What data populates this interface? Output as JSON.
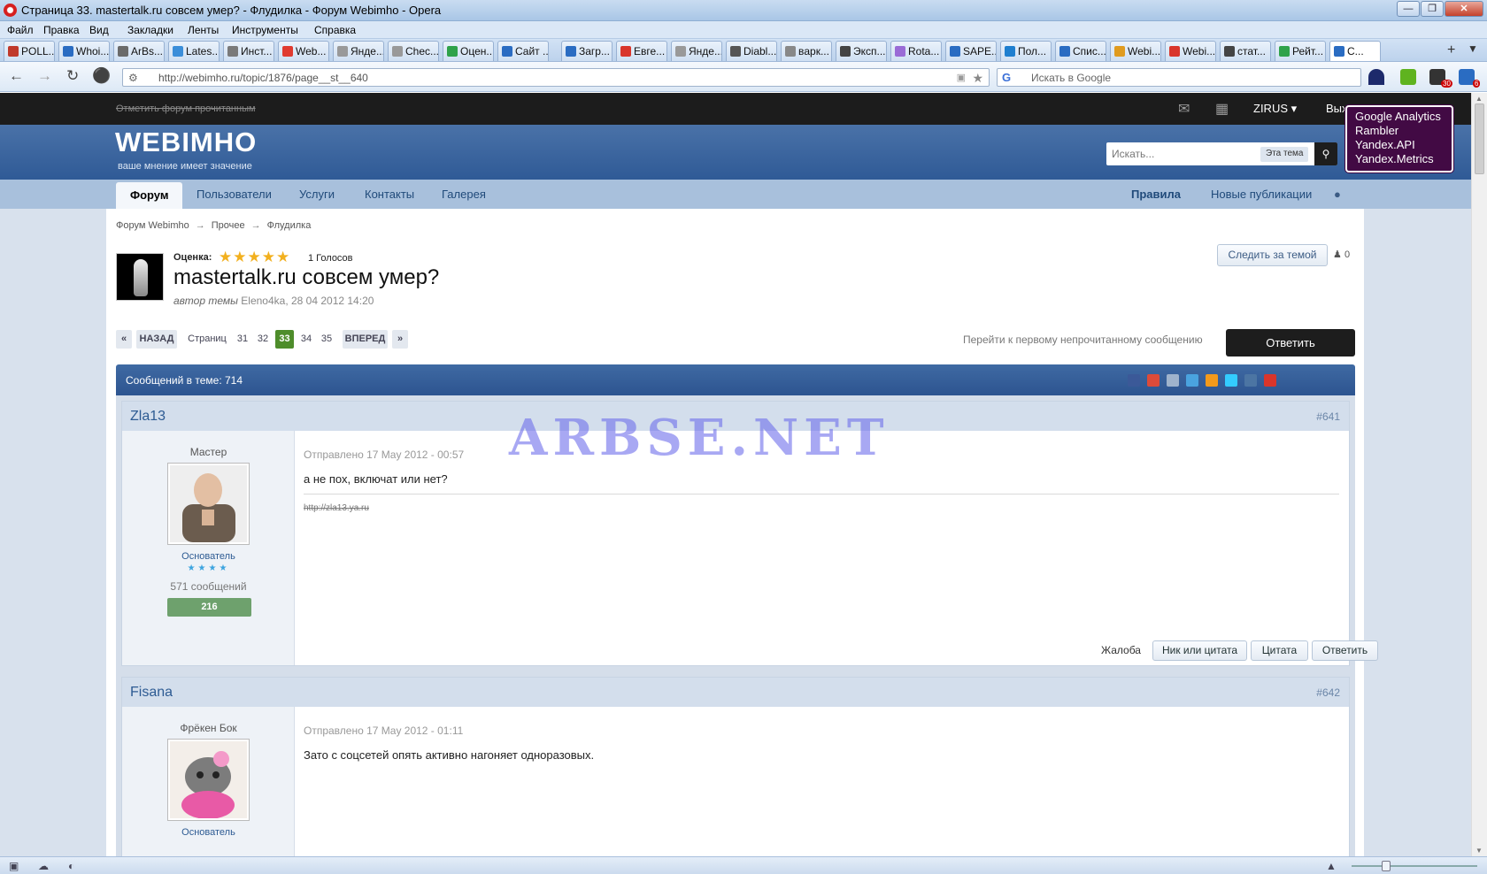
{
  "window": {
    "title": "Страница 33. mastertalk.ru совсем умер? - Флудилка - Форум Webimho - Opera",
    "controls": [
      "minimize",
      "maximize",
      "close"
    ]
  },
  "menu": [
    "Файл",
    "Правка",
    "Вид",
    "Закладки",
    "Ленты",
    "Инструменты",
    "Справка"
  ],
  "tabs": [
    {
      "label": "POLL...",
      "color": "#c0392b"
    },
    {
      "label": "Whoi...",
      "color": "#2a6cc2"
    },
    {
      "label": "ArBs...",
      "color": "#6a6a6a"
    },
    {
      "label": "Lates...",
      "color": "#3b8ed9"
    },
    {
      "label": "Инст...",
      "color": "#7a7a7a"
    },
    {
      "label": "Web...",
      "color": "#e03a2f"
    },
    {
      "label": "Янде...",
      "color": "#999999"
    },
    {
      "label": "Chec...",
      "color": "#999999"
    },
    {
      "label": "Оцен...",
      "color": "#2fa24a"
    },
    {
      "label": "Сайт ...",
      "color": "#2a6cc2"
    },
    {
      "label": "Загр...",
      "color": "#2a6cc2"
    },
    {
      "label": "Евге...",
      "color": "#d9352b"
    },
    {
      "label": "Янде...",
      "color": "#999999"
    },
    {
      "label": "Diabl...",
      "color": "#555555"
    },
    {
      "label": "вapк...",
      "color": "#888888"
    },
    {
      "label": "Эксп...",
      "color": "#444444"
    },
    {
      "label": "Rota...",
      "color": "#9a6bd6"
    },
    {
      "label": "SAPE...",
      "color": "#2a6cc2"
    },
    {
      "label": "Пол...",
      "color": "#1f7fcf"
    },
    {
      "label": "Спис...",
      "color": "#2a6cc2"
    },
    {
      "label": "Webi...",
      "color": "#e09b1f"
    },
    {
      "label": "Webi...",
      "color": "#d9352b"
    },
    {
      "label": "стат...",
      "color": "#444444"
    },
    {
      "label": "Рейт...",
      "color": "#2fa24a"
    },
    {
      "label": "C...",
      "color": "#2a6cc2",
      "active": true
    }
  ],
  "address": {
    "url": "http://webimho.ru/topic/1876/page__st__640",
    "search_placeholder": "Искать в Google"
  },
  "extensions": {
    "badge_speed_dial": "30",
    "badge_mail": "6"
  },
  "site": {
    "mark_read": "Отметить форум прочитанным",
    "username": "ZIRUS",
    "logout": "Вых",
    "logo": "WEBIMHO",
    "slogan": "ваше мнение имеет значение",
    "search_placeholder": "Искать...",
    "search_scope": "Эта тема",
    "tooltip": [
      "Google Analytics",
      "Rambler",
      "Yandex.API",
      "Yandex.Metrics"
    ],
    "nav": [
      "Форум",
      "Пользователи",
      "Услуги",
      "Контакты",
      "Галерея"
    ],
    "nav_right": [
      "Правила",
      "Новые публикации"
    ],
    "breadcrumb": [
      "Форум Webimho",
      "Прочее",
      "Флудилка"
    ]
  },
  "topic": {
    "rating_label": "Оценка:",
    "rating": 5,
    "rating_max": 5,
    "votes": "1 Голосов",
    "title": "mastertalk.ru совсем умер?",
    "meta_prefix": "автор темы",
    "meta_author": "Eleno4ka, 28 04 2012 14:20",
    "follow": "Следить за темой",
    "followers": "0",
    "pager": {
      "first": "«",
      "prev": "НАЗАД",
      "pages_label": "Страниц",
      "pages": [
        "31",
        "32",
        "33",
        "34",
        "35"
      ],
      "current": "33",
      "next": "ВПЕРЕД",
      "last": "»"
    },
    "first_unread": "Перейти к первому непрочитанному сообщению",
    "reply": "Ответить",
    "posts_count": "Сообщений в теме: 714",
    "share": [
      "facebook",
      "google-plus",
      "edit",
      "settings",
      "odnoklassniki",
      "twitter",
      "vkontakte",
      "report"
    ]
  },
  "posts": [
    {
      "author": "Zla13",
      "number": "#641",
      "member_title": "Мастер",
      "group": "Основатель",
      "pips": "★★★★",
      "post_count": "571 сообщений",
      "reputation": "216",
      "date": "Отправлено 17 May 2012 - 00:57",
      "text": "а не пох, включат или нет?",
      "signature": "http://zla13.ya.ru",
      "actions": {
        "report": "Жалоба",
        "nick_quote": "Ник или цитата",
        "quote": "Цитата",
        "reply": "Ответить"
      }
    },
    {
      "author": "Fisana",
      "number": "#642",
      "member_title": "Фрёкен Бок",
      "group": "Основатель",
      "date": "Отправлено 17 May 2012 - 01:11",
      "text": "Зато с соцсетей опять активно нагоняет одноразовых."
    }
  ],
  "watermark": "ARBSE.NET"
}
